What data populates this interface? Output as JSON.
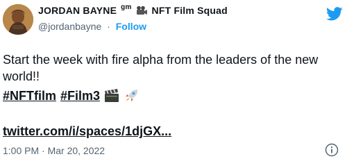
{
  "author": {
    "name": "JORDAN BAYNE",
    "name_suffix": "gm",
    "team": "NFT Film Squad",
    "handle": "@jordanbayne",
    "separator": "·",
    "follow_label": "Follow"
  },
  "tweet": {
    "text": "Start the week with fire alpha from the leaders of the new world!!",
    "hashtags": [
      "#NFTfilm",
      "#Film3"
    ],
    "link": "twitter.com/i/spaces/1djGX...",
    "timestamp": "1:00 PM · Mar 20, 2022"
  },
  "icons": {
    "camera": "movie-camera-icon",
    "bird": "twitter-bird-icon",
    "clapper": "clapper-board-icon",
    "rocket": "rocket-icon",
    "info": "info-icon"
  },
  "colors": {
    "accent": "#1d9bf0",
    "text": "#0f1419",
    "muted": "#536471"
  }
}
